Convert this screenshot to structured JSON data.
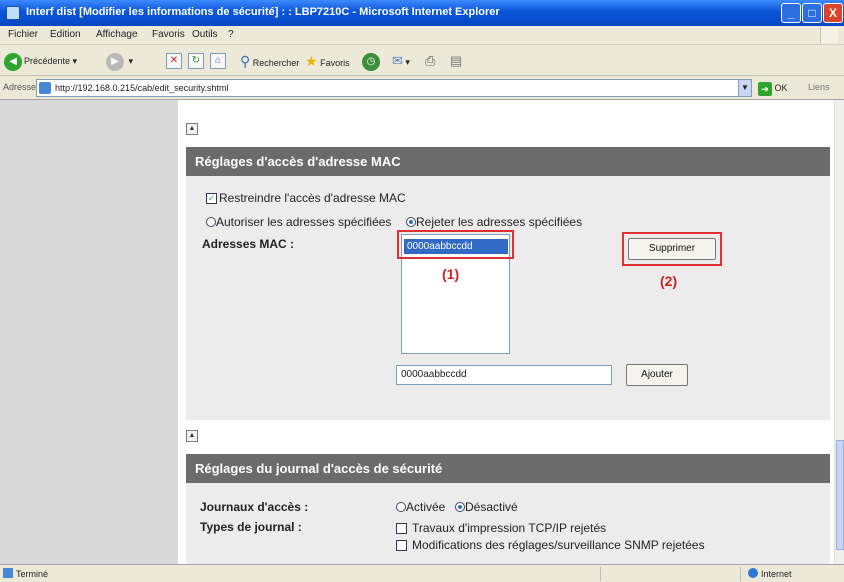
{
  "window": {
    "title": "Interf dist [Modifier les informations de sécurité] : : LBP7210C - Microsoft Internet Explorer",
    "min_glyph": "_",
    "max_glyph": "□",
    "close_glyph": "X"
  },
  "menu": [
    "Fichier",
    "Edition",
    "Affichage",
    "Favoris",
    "Outils",
    "?"
  ],
  "toolbar": {
    "back_label": "Précédente",
    "search_label": "Rechercher",
    "favorites_label": "Favoris"
  },
  "address": {
    "label": "Adresse",
    "url": "http://192.168.0.215/cab/edit_security.shtml",
    "go_label": "OK",
    "links_label": "Liens"
  },
  "mac_section": {
    "header": "Réglages d'accès d'adresse MAC",
    "restrict_label": "Restreindre l'accès d'adresse MAC",
    "restrict_checked": true,
    "allow_label": "Autoriser les adresses spécifiées",
    "reject_label": "Rejeter les adresses spécifiées",
    "selected_mode": "reject",
    "addresses_label": "Adresses MAC :",
    "list_items": [
      "0000aabbccdd"
    ],
    "delete_button": "Supprimer",
    "input_value": "0000aabbccdd",
    "add_button": "Ajouter",
    "annotation_1": "(1)",
    "annotation_2": "(2)"
  },
  "log_section": {
    "header": "Réglages du journal d'accès de sécurité",
    "access_logs_label": "Journaux d'accès :",
    "enabled_label": "Activée",
    "disabled_label": "Désactivé",
    "selected": "disabled",
    "log_types_label": "Types de journal :",
    "type1": "Travaux d'impression TCP/IP rejetés",
    "type2": "Modifications des réglages/surveillance SNMP rejetées"
  },
  "status": {
    "left": "Terminé",
    "zone": "Internet"
  },
  "colors": {
    "section_header": "#6b6b6b",
    "highlight": "#e03030",
    "selection": "#316ac5"
  }
}
